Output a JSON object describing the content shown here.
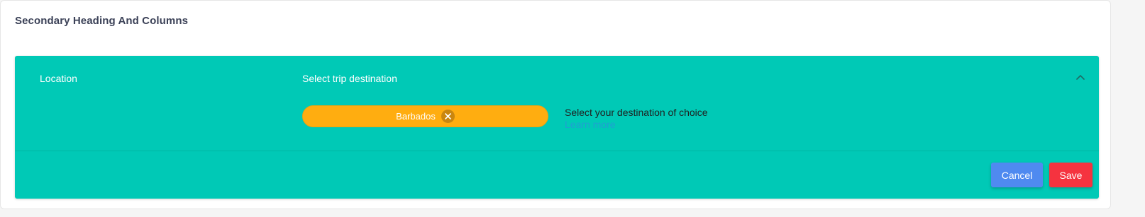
{
  "section": {
    "title": "Secondary Heading And Columns"
  },
  "panel": {
    "label": "Location",
    "column_heading": "Select trip destination",
    "collapse_icon": "chevron-up-icon",
    "chip": {
      "value": "Barbados",
      "remove_icon": "close-circle-icon"
    },
    "help": {
      "text": "Select your destination of choice",
      "link": "Learn more"
    },
    "actions": {
      "cancel_label": "Cancel",
      "save_label": "Save"
    }
  },
  "colors": {
    "panel_bg": "#00c9b6",
    "chip_bg": "#ffad10",
    "cancel_bg": "#4f8af0",
    "save_bg": "#f5333f",
    "title_text": "#3b4157"
  }
}
